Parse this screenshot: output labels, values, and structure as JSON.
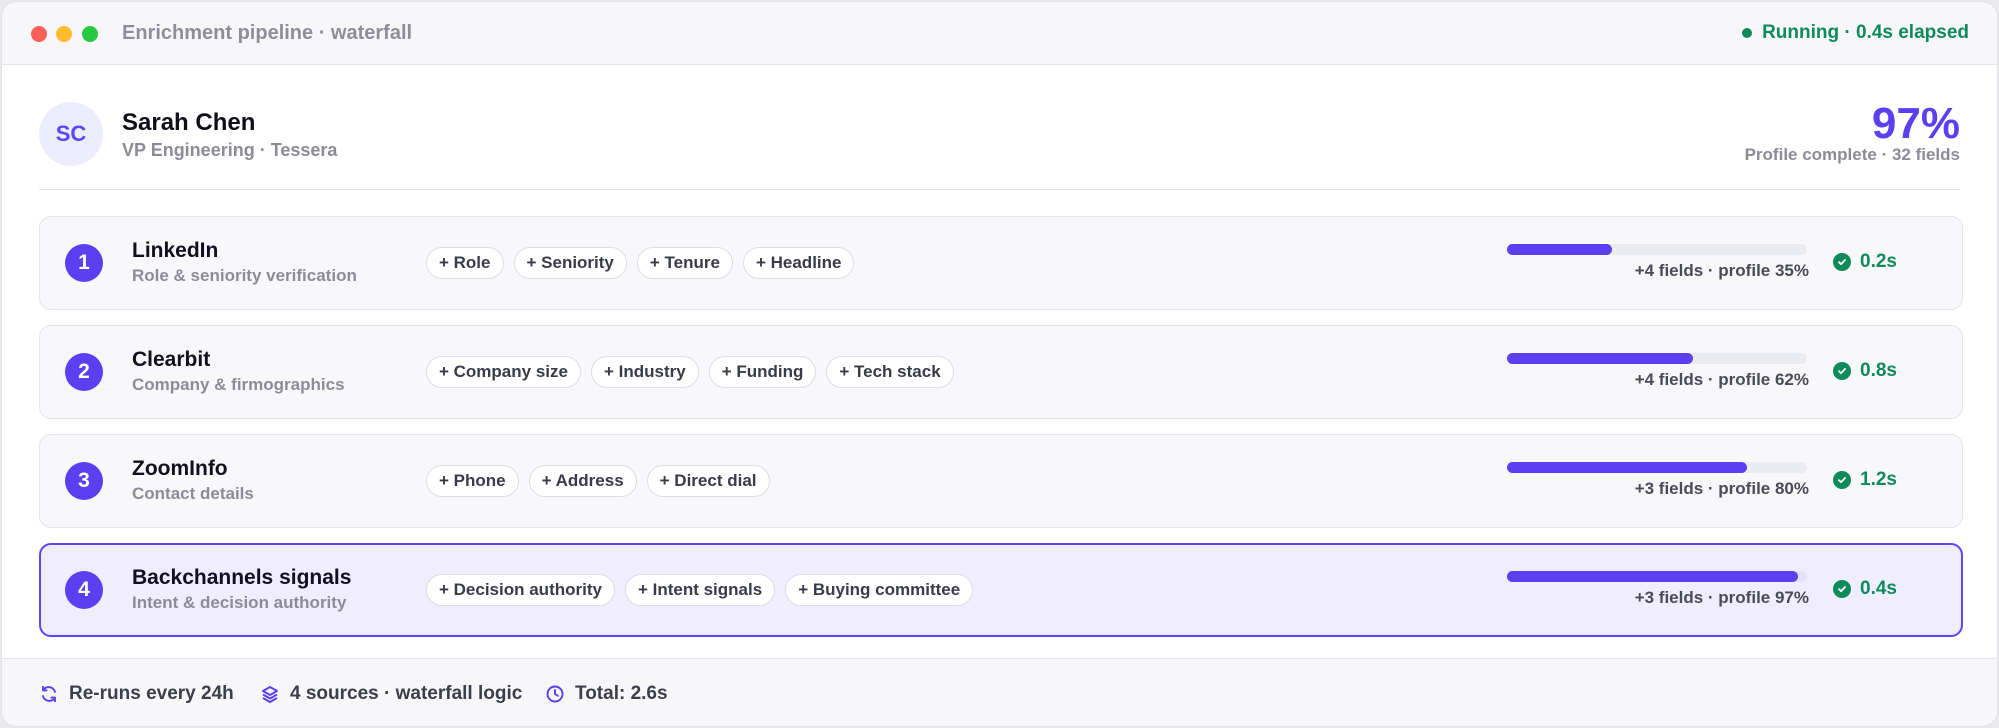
{
  "window": {
    "title": "Enrichment pipeline · waterfall",
    "status": "Running · 0.4s elapsed"
  },
  "profile": {
    "initials": "SC",
    "name": "Sarah Chen",
    "role": "VP Engineering · Tessera",
    "score": "97%",
    "score_label": "Profile complete · 32 fields"
  },
  "colors": {
    "accent": "#5b3ff0",
    "success": "#0f8a5b",
    "active_row_bg": "#efedfe"
  },
  "sources": [
    {
      "step": "1",
      "name": "LinkedIn",
      "desc": "Role & seniority verification",
      "chips": [
        "+ Role",
        "+ Seniority",
        "+ Tenure",
        "+ Headline"
      ],
      "progress": 0.35,
      "meta": "+4 fields · profile 35%",
      "time": "0.2s",
      "active": false
    },
    {
      "step": "2",
      "name": "Clearbit",
      "desc": "Company & firmographics",
      "chips": [
        "+ Company size",
        "+ Industry",
        "+ Funding",
        "+ Tech stack"
      ],
      "progress": 0.62,
      "meta": "+4 fields · profile 62%",
      "time": "0.8s",
      "active": false
    },
    {
      "step": "3",
      "name": "ZoomInfo",
      "desc": "Contact details",
      "chips": [
        "+ Phone",
        "+ Address",
        "+ Direct dial"
      ],
      "progress": 0.8,
      "meta": "+3 fields · profile 80%",
      "time": "1.2s",
      "active": false
    },
    {
      "step": "4",
      "name": "Backchannels signals",
      "desc": "Intent & decision authority",
      "chips": [
        "+ Decision authority",
        "+ Intent signals",
        "+ Buying committee"
      ],
      "progress": 0.97,
      "meta": "+3 fields · profile 97%",
      "time": "0.4s",
      "active": true
    }
  ],
  "footer": {
    "rerun": "Re-runs every 24h",
    "sources": "4 sources · waterfall logic",
    "total": "Total: 2.6s"
  },
  "icons": {
    "rerun": "refresh-icon",
    "sources": "layers-icon",
    "total": "clock-icon",
    "done": "check-circle-icon"
  }
}
